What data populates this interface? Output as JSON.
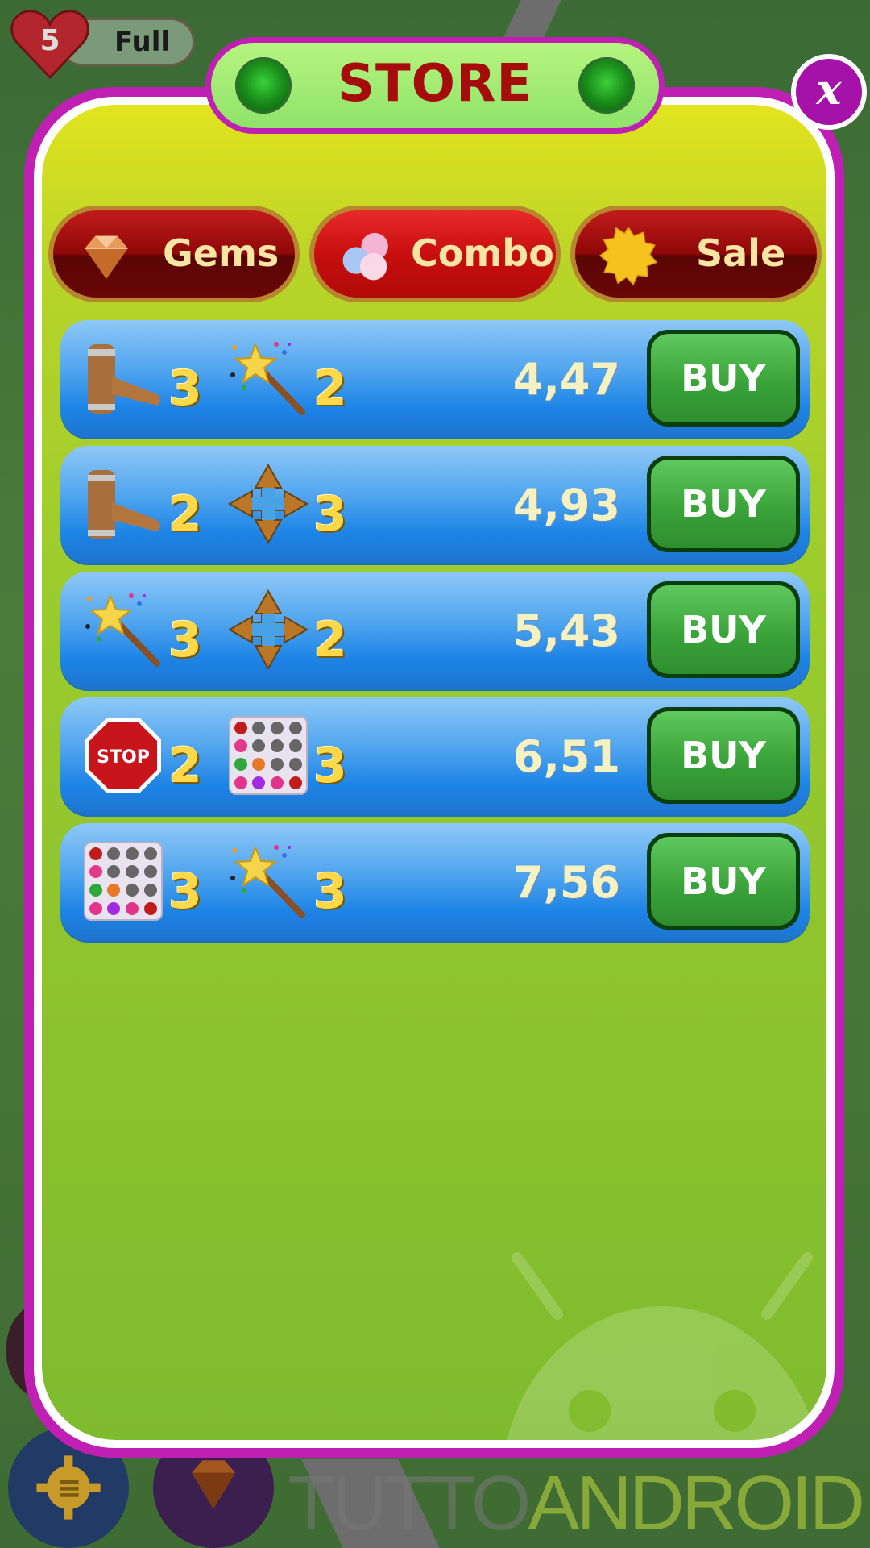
{
  "hud": {
    "lives": "5",
    "lives_status": "Full"
  },
  "store": {
    "title": "STORE",
    "close_label": "x",
    "tabs": [
      {
        "label": "Gems",
        "icon": "gem-icon",
        "active": false
      },
      {
        "label": "Combo",
        "icon": "bubbles-icon",
        "active": true
      },
      {
        "label": "Sale",
        "icon": "sale-badge-icon",
        "active": false
      }
    ],
    "offers": [
      {
        "item1": {
          "icon": "hammer-icon",
          "qty": "3"
        },
        "item2": {
          "icon": "magic-wand-icon",
          "qty": "2"
        },
        "price": "4,47",
        "buy_label": "BUY"
      },
      {
        "item1": {
          "icon": "hammer-icon",
          "qty": "2"
        },
        "item2": {
          "icon": "arrows-icon",
          "qty": "3"
        },
        "price": "4,93",
        "buy_label": "BUY"
      },
      {
        "item1": {
          "icon": "magic-wand-icon",
          "qty": "3"
        },
        "item2": {
          "icon": "arrows-icon",
          "qty": "2"
        },
        "price": "5,43",
        "buy_label": "BUY"
      },
      {
        "item1": {
          "icon": "stop-sign-icon",
          "qty": "2"
        },
        "item2": {
          "icon": "color-grid-icon",
          "qty": "3"
        },
        "price": "6,51",
        "buy_label": "BUY"
      },
      {
        "item1": {
          "icon": "color-grid-icon",
          "qty": "3"
        },
        "item2": {
          "icon": "magic-wand-icon",
          "qty": "3"
        },
        "price": "7,56",
        "buy_label": "BUY"
      }
    ],
    "stop_sign_text": "STOP"
  },
  "watermark": {
    "part1": "TUTTO",
    "part2": "ANDROID"
  },
  "colors": {
    "panel_border": "#c01fb3",
    "title_text": "#a50c0c",
    "buy_green": "#3aa33a",
    "row_blue": "#1d84e6"
  }
}
